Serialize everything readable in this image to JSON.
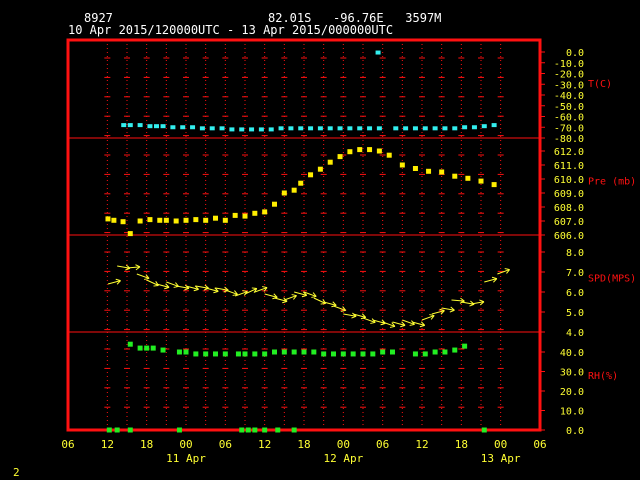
{
  "header": {
    "station": "8927",
    "location": "82.01S   -96.76E   3597M",
    "time_range": "10 Apr 2015/120000UTC - 13 Apr 2015/000000UTC"
  },
  "page_number": "2",
  "colors": {
    "frame": "#ff1111",
    "tick_text": "#ffff33",
    "axis_label": "#ff1111",
    "temperature": "#33eeee",
    "pressure": "#ffee00",
    "wind": "#ffff33",
    "rh": "#22ee22"
  },
  "chart_data": [
    {
      "type": "scatter",
      "panel": "temperature",
      "ylabel": "T(C)",
      "ylim": [
        -80,
        0
      ],
      "yticks": [
        "0.0",
        "-10.0",
        "-20.0",
        "-30.0",
        "-40.0",
        "-50.0",
        "-60.0",
        "-70.0",
        "-80.0"
      ],
      "x": [
        14.5,
        15.5,
        17,
        18.5,
        19.5,
        20.5,
        22,
        23.5,
        25,
        26.5,
        28,
        29.5,
        31,
        32.5,
        34,
        35.5,
        37,
        38.5,
        40,
        41.5,
        43,
        44.5,
        46,
        47.5,
        49,
        50.5,
        52,
        53.5,
        56,
        57.5,
        59,
        60.5,
        62,
        63.5,
        65,
        66.5,
        68,
        69.5,
        71
      ],
      "y": [
        -68,
        -68,
        -68,
        -69,
        -69,
        -69,
        -70,
        -70,
        -70,
        -71,
        -71,
        -71,
        -72,
        -72,
        -72,
        -72,
        -72,
        -71,
        -71,
        -71,
        -71,
        -71,
        -71,
        -71,
        -71,
        -71,
        -71,
        -71,
        -71,
        -71,
        -71,
        -71,
        -71,
        -71,
        -71,
        -70,
        -70,
        -69,
        -68
      ],
      "series": [
        {
          "name": "",
          "x": [
            53.3
          ],
          "y": [
            -0.5
          ]
        }
      ]
    },
    {
      "type": "scatter",
      "panel": "pressure",
      "ylabel": "Pre (mb)",
      "ylim": [
        606,
        612
      ],
      "yticks": [
        "612.0",
        "611.0",
        "610.0",
        "609.0",
        "608.0",
        "607.0",
        "606.0"
      ],
      "x": [
        12.1,
        13,
        14.4,
        15.5,
        17,
        18.5,
        20,
        21,
        22.5,
        24,
        25.5,
        27,
        28.5,
        30,
        31.5,
        33,
        34.5,
        36,
        37.5,
        39,
        40.5,
        41.5,
        43,
        44.5,
        46,
        47.5,
        49,
        50.5,
        52,
        53.5,
        55,
        57,
        59,
        61,
        63,
        65,
        67,
        69,
        71
      ],
      "y": [
        607.15,
        607.05,
        606.95,
        606.1,
        607.0,
        607.1,
        607.05,
        607.05,
        607.0,
        607.05,
        607.1,
        607.05,
        607.2,
        607.05,
        607.4,
        607.35,
        607.55,
        607.65,
        608.2,
        609.0,
        609.2,
        609.7,
        610.3,
        610.7,
        611.2,
        611.6,
        611.95,
        612.1,
        612.1,
        612.0,
        611.7,
        611.0,
        610.75,
        610.55,
        610.5,
        610.2,
        610.05,
        609.85,
        609.6
      ]
    },
    {
      "type": "scatter",
      "panel": "wind_speed",
      "ylabel": "SPD(MPS)",
      "ylim": [
        4,
        8
      ],
      "yticks": [
        "8.0",
        "7.0",
        "6.0",
        "5.0",
        "4.0"
      ],
      "x": [
        12.1,
        13.5,
        15,
        16.5,
        18,
        19.5,
        21,
        22.5,
        24,
        25.5,
        27,
        28.5,
        30,
        31.5,
        33,
        34.5,
        36,
        37.5,
        39,
        40.5,
        42,
        43.5,
        45,
        46.5,
        48,
        49.5,
        51,
        52.5,
        54,
        55.5,
        57,
        58.5,
        60,
        61.5,
        63,
        64.5,
        66,
        67.5,
        69.5,
        71.5
      ],
      "y": [
        6.4,
        7.3,
        7.2,
        6.9,
        6.6,
        6.4,
        6.5,
        6.3,
        6.3,
        6.3,
        6.2,
        6.2,
        6.1,
        5.8,
        5.9,
        6.0,
        5.9,
        5.7,
        5.6,
        6.0,
        6.0,
        5.7,
        5.5,
        5.3,
        4.9,
        4.9,
        4.7,
        4.6,
        4.5,
        4.5,
        4.6,
        4.5,
        4.6,
        4.9,
        5.2,
        5.6,
        5.5,
        5.4,
        6.5,
        6.9
      ],
      "direction_deg": [
        -15,
        10,
        -5,
        20,
        25,
        15,
        20,
        10,
        15,
        10,
        15,
        10,
        20,
        -20,
        -25,
        -20,
        15,
        15,
        -20,
        15,
        20,
        25,
        15,
        20,
        10,
        15,
        20,
        15,
        20,
        15,
        20,
        15,
        -20,
        -15,
        10,
        5,
        10,
        -10,
        -15,
        -20
      ]
    },
    {
      "type": "scatter",
      "panel": "relative_humidity",
      "ylabel": "RH(%)",
      "ylim": [
        0,
        40
      ],
      "yticks": [
        "40.0",
        "30.0",
        "20.0",
        "10.0",
        "0.0"
      ],
      "x": [
        15.5,
        17,
        18,
        19,
        20.5,
        23,
        24,
        25.5,
        27,
        28.5,
        30,
        32,
        33,
        34.5,
        36,
        37.5,
        39,
        40.5,
        42,
        43.5,
        45,
        46.5,
        48,
        49.5,
        51,
        52.5,
        54,
        55.5,
        59,
        60.5,
        62,
        63.5,
        65,
        66.5
      ],
      "y": [
        44,
        42,
        42,
        42,
        41,
        40,
        40,
        39,
        39,
        39,
        39,
        39,
        39,
        39,
        39,
        40,
        40,
        40,
        40,
        40,
        39,
        39,
        39,
        39,
        39,
        39,
        40,
        40,
        39,
        39,
        40,
        40,
        41,
        43
      ],
      "series": [
        {
          "name": "",
          "x": [
            12.3,
            13.5,
            15.5,
            23,
            32.5,
            33.5,
            34.5,
            36,
            38,
            40.5,
            69.5
          ],
          "y": [
            0,
            0,
            0,
            0,
            0,
            0,
            0,
            0,
            0,
            0,
            0
          ]
        }
      ]
    },
    {
      "type": "time_axis",
      "xlim": [
        6,
        78
      ],
      "xticks": [
        "06",
        "12",
        "18",
        "00",
        "06",
        "12",
        "18",
        "00",
        "06",
        "12",
        "18",
        "00",
        "06"
      ],
      "day_labels": [
        "11 Apr",
        "12 Apr",
        "13 Apr"
      ]
    }
  ]
}
